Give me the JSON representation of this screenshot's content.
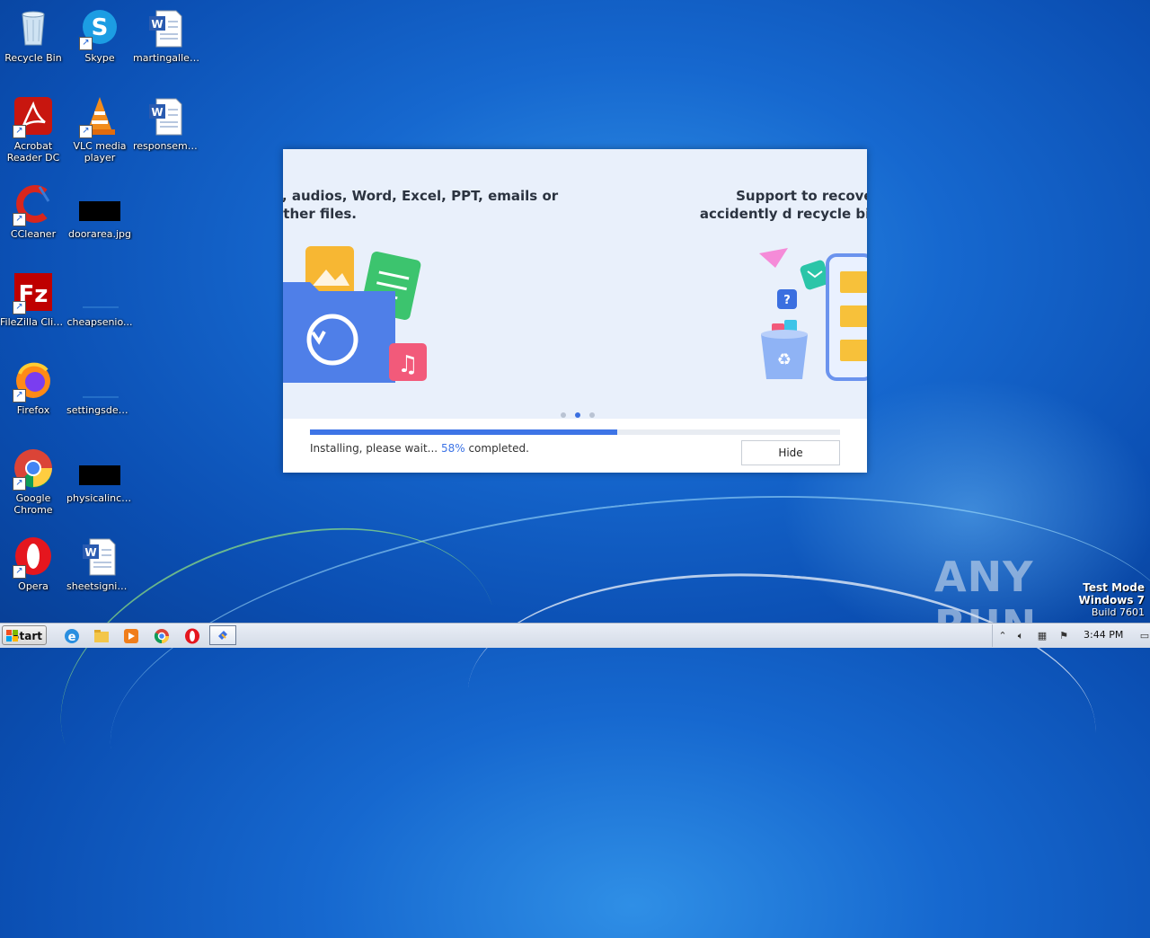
{
  "desktop": {
    "icons": [
      {
        "label": "Recycle Bin",
        "icon": "recycle-bin-icon"
      },
      {
        "label": "Skype",
        "icon": "skype-icon"
      },
      {
        "label": "martingaller...",
        "icon": "word-document-icon"
      },
      {
        "label": "Acrobat Reader DC",
        "icon": "acrobat-reader-icon"
      },
      {
        "label": "VLC media player",
        "icon": "vlc-icon"
      },
      {
        "label": "responsemi...",
        "icon": "word-document-icon"
      },
      {
        "label": "CCleaner",
        "icon": "ccleaner-icon"
      },
      {
        "label": "doorarea.jpg",
        "icon": "image-file-icon"
      },
      {
        "label": "FileZilla Client",
        "icon": "filezilla-icon"
      },
      {
        "label": "cheapsenio...",
        "icon": "blank-file-icon"
      },
      {
        "label": "Firefox",
        "icon": "firefox-icon"
      },
      {
        "label": "settingsdefi...",
        "icon": "blank-file-icon"
      },
      {
        "label": "Google Chrome",
        "icon": "chrome-icon"
      },
      {
        "label": "physicalinclu...",
        "icon": "image-file-icon"
      },
      {
        "label": "Opera",
        "icon": "opera-icon"
      },
      {
        "label": "sheetsignific...",
        "icon": "word-document-icon"
      }
    ]
  },
  "installer": {
    "slide_left_text": "s, audios, Word, Excel, PPT, emails or other files.",
    "slide_right_text": "Support to recover accidently d recycle bin",
    "progress_fraction": 0.58,
    "status_prefix": "Installing, please wait...",
    "status_percent": "58%",
    "status_suffix": "completed.",
    "hide_label": "Hide",
    "accent_color": "#3d74e6"
  },
  "taskbar": {
    "start_label": "Start",
    "clock": "3:44 PM"
  },
  "watermark": {
    "text": "ANY RUN",
    "line1": "Test Mode",
    "line2": "Windows 7",
    "line3": "Build 7601"
  }
}
